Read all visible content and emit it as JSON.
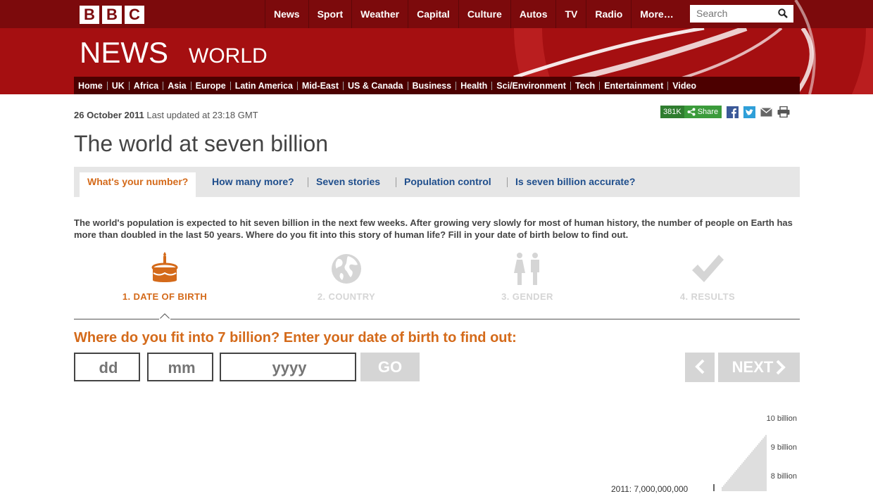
{
  "brand": {
    "letters": [
      "B",
      "B",
      "C"
    ],
    "news": "NEWS",
    "edition": "WORLD"
  },
  "topnav": [
    "News",
    "Sport",
    "Weather",
    "Capital",
    "Culture",
    "Autos",
    "TV",
    "Radio",
    "More…"
  ],
  "search": {
    "placeholder": "Search"
  },
  "secnav": [
    "Home",
    "UK",
    "Africa",
    "Asia",
    "Europe",
    "Latin America",
    "Mid-East",
    "US & Canada",
    "Business",
    "Health",
    "Sci/Environment",
    "Tech",
    "Entertainment",
    "Video"
  ],
  "article": {
    "date": "26 October 2011",
    "updated": "Last updated at 23:18 GMT",
    "share_count": "381K",
    "share_label": "Share",
    "headline": "The world at seven billion"
  },
  "tabs": [
    "What's your number?",
    "How many more?",
    "Seven stories",
    "Population control",
    "Is seven billion accurate?"
  ],
  "intro": "The world's population is expected to hit seven billion in the next few weeks. After growing very slowly for most of human history, the number of people on Earth has more than doubled in the last 50 years. Where do you fit into this story of human life? Fill in your date of birth below to find out.",
  "steps": [
    "1. DATE OF BIRTH",
    "2. COUNTRY",
    "3. GENDER",
    "4. RESULTS"
  ],
  "form": {
    "question": "Where do you fit into 7 billion? Enter your date of birth to find out:",
    "dd_placeholder": "dd",
    "mm_placeholder": "mm",
    "yyyy_placeholder": "yyyy",
    "go_label": "GO",
    "next_label": "NEXT"
  },
  "chart_data": {
    "type": "area",
    "title": "",
    "ylabel": "",
    "tick_labels": [
      "10 billion",
      "9 billion",
      "8 billion"
    ],
    "annotation": "2011: 7,000,000,000"
  },
  "colors": {
    "brand_red": "#a50f11",
    "accent_orange": "#d46a1a",
    "link_blue": "#1f4e8c",
    "disabled_grey": "#d5d5d5"
  }
}
